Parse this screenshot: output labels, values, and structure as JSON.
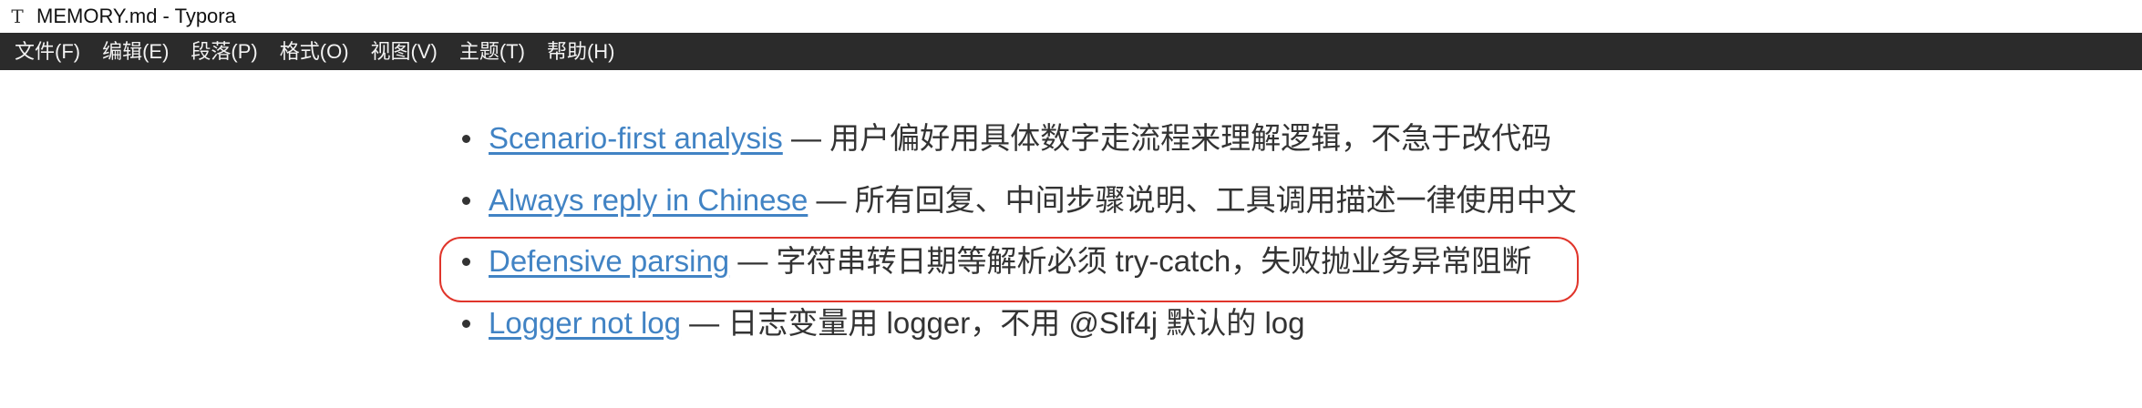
{
  "window": {
    "app_icon": "typora-icon",
    "title": "MEMORY.md - Typora"
  },
  "menubar": {
    "items": [
      {
        "label": "文件(F)"
      },
      {
        "label": "编辑(E)"
      },
      {
        "label": "段落(P)"
      },
      {
        "label": "格式(O)"
      },
      {
        "label": "视图(V)"
      },
      {
        "label": "主题(T)"
      },
      {
        "label": "帮助(H)"
      }
    ]
  },
  "document": {
    "items": [
      {
        "link": "Scenario-first analysis",
        "text": " — 用户偏好用具体数字走流程来理解逻辑，不急于改代码"
      },
      {
        "link": "Always reply in Chinese",
        "text": " — 所有回复、中间步骤说明、工具调用描述一律使用中文"
      },
      {
        "link": "Defensive parsing",
        "text": " — 字符串转日期等解析必须 try-catch，失败抛业务异常阻断"
      },
      {
        "link": "Logger not log",
        "text": " — 日志变量用 logger，不用 @Slf4j 默认的 log"
      }
    ]
  },
  "colors": {
    "menubar_bg": "#2b2b2b",
    "link": "#4183c4",
    "highlight_outline": "#e0352b"
  }
}
